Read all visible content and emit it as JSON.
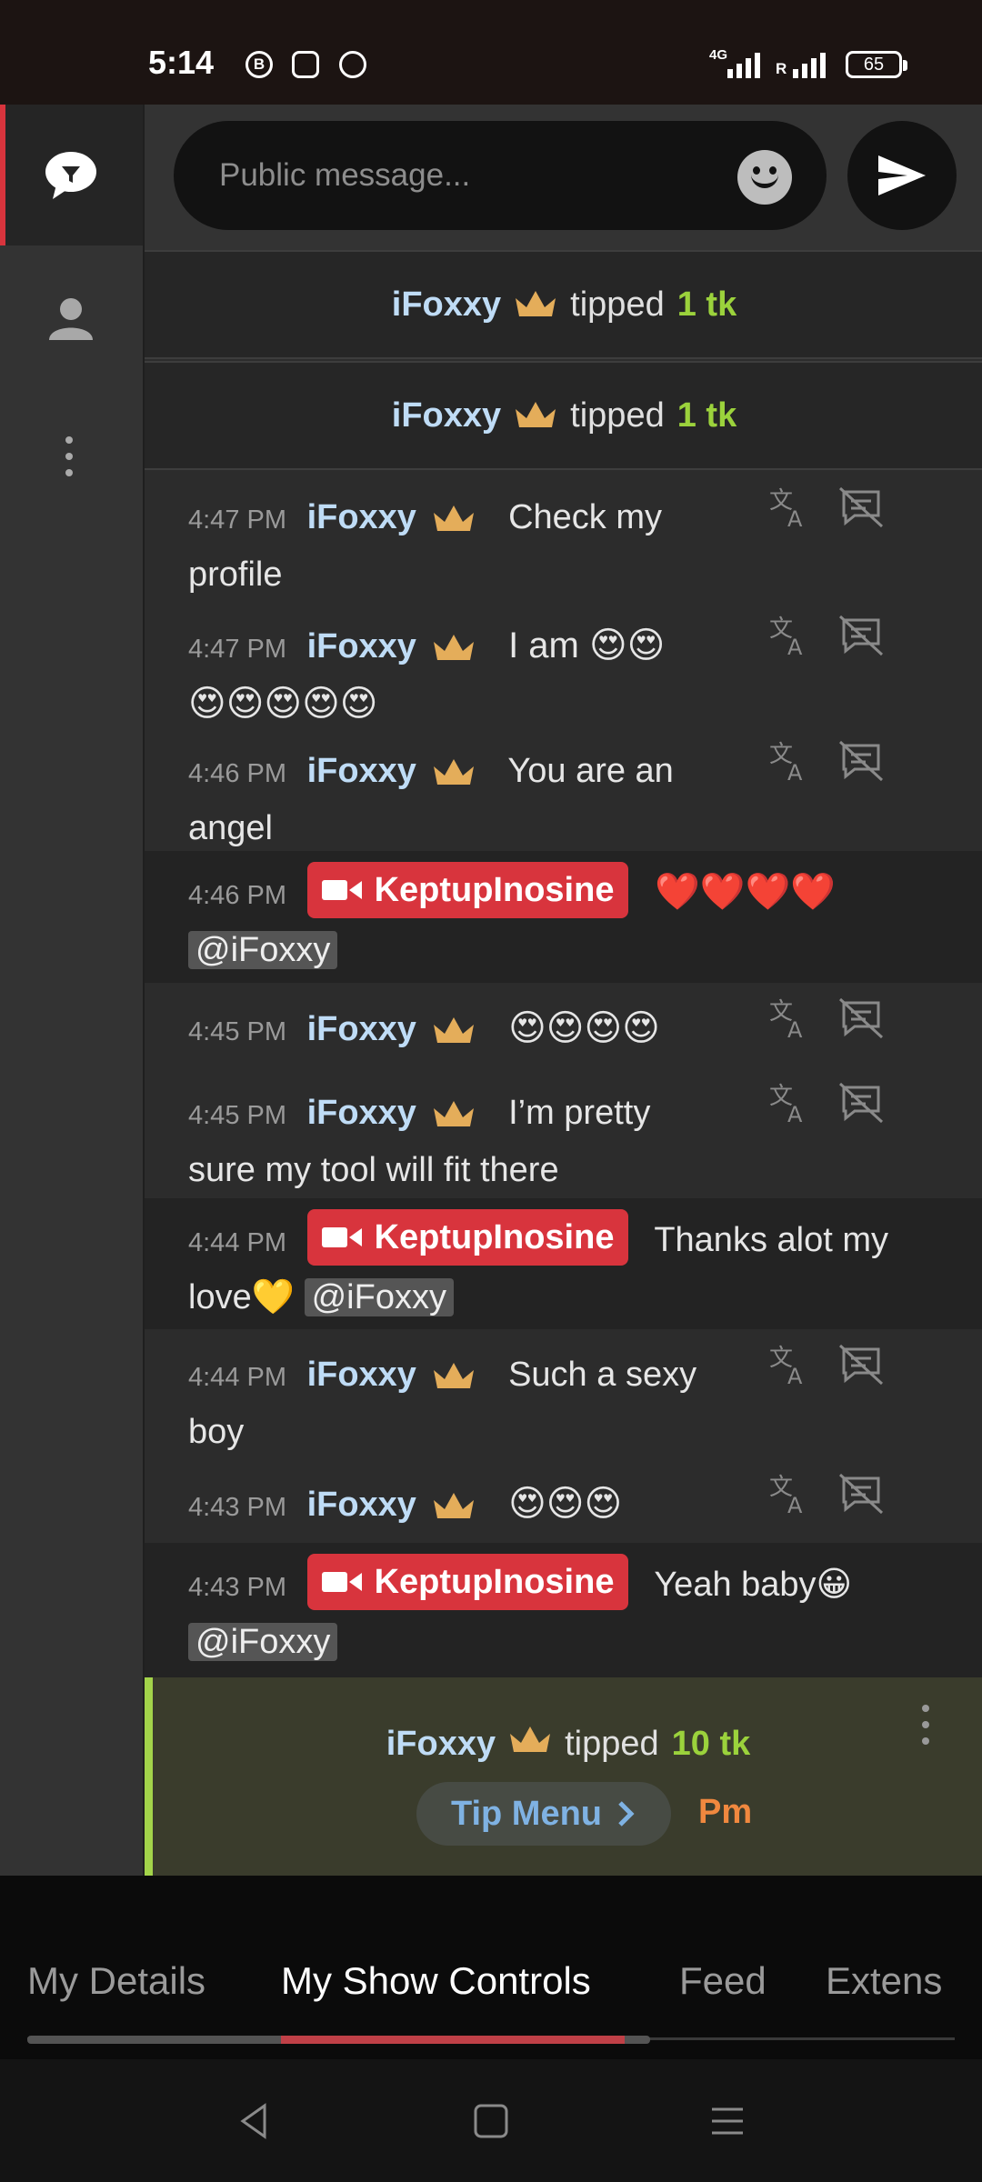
{
  "status_bar": {
    "time": "5:14",
    "network": "4G",
    "roaming": "R",
    "battery": "65",
    "apps": [
      "B"
    ]
  },
  "composer": {
    "placeholder": "Public message..."
  },
  "tips_top": [
    {
      "user": "iFoxxy",
      "action": "tipped",
      "amount": "1 tk"
    },
    {
      "user": "iFoxxy",
      "action": "tipped",
      "amount": "1 tk"
    }
  ],
  "messages": [
    {
      "time": "4:47 PM",
      "user": "iFoxxy",
      "text": "Check my",
      "text2": "profile"
    },
    {
      "time": "4:47 PM",
      "user": "iFoxxy",
      "text": "I am 😍😍",
      "text2": "😍😍😍😍😍"
    },
    {
      "time": "4:46 PM",
      "user": "iFoxxy",
      "text": "You are an",
      "text2": "angel"
    },
    {
      "time": "4:46 PM",
      "user": "KeptupInosine",
      "text": "❤️❤️❤️❤️",
      "mention": "@iFoxxy"
    },
    {
      "time": "4:45 PM",
      "user": "iFoxxy",
      "text": "😍😍😍😍"
    },
    {
      "time": "4:45 PM",
      "user": "iFoxxy",
      "text": "I’m pretty",
      "text2": "sure my tool will fit there"
    },
    {
      "time": "4:44 PM",
      "user": "KeptupInosine",
      "text": "Thanks alot my",
      "text2": "love💛",
      "mention": "@iFoxxy"
    },
    {
      "time": "4:44 PM",
      "user": "iFoxxy",
      "text": "Such a sexy",
      "text2": "boy"
    },
    {
      "time": "4:43 PM",
      "user": "iFoxxy",
      "text": "😍😍😍"
    },
    {
      "time": "4:43 PM",
      "user": "KeptupInosine",
      "text": "Yeah baby😀",
      "mention": "@iFoxxy"
    }
  ],
  "last_tip": {
    "user": "iFoxxy",
    "action": "tipped",
    "amount": "10 tk",
    "tip_menu": "Tip Menu",
    "pm": "Pm"
  },
  "tabs": [
    "My Details",
    "My Show Controls",
    "Feed",
    "Extens"
  ],
  "active_tab": "My Show Controls",
  "colors": {
    "accent_red": "#d8343d",
    "username_blue": "#bfdcf6",
    "token_green": "#9bd23c",
    "pm_orange": "#f0883f"
  }
}
